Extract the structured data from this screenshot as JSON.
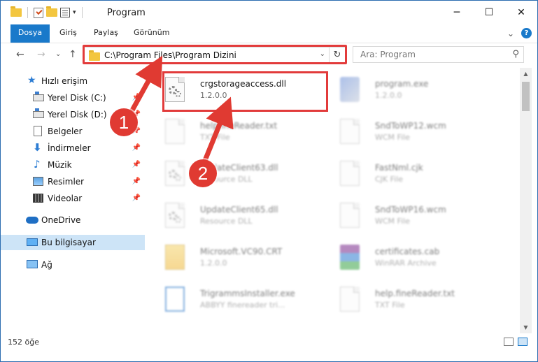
{
  "window": {
    "title": "Program",
    "controls": {
      "minimize": "─",
      "maximize": "☐",
      "close": "✕"
    }
  },
  "ribbon": {
    "tabs": [
      {
        "label": "Dosya",
        "active": true
      },
      {
        "label": "Giriş"
      },
      {
        "label": "Paylaş"
      },
      {
        "label": "Görünüm"
      }
    ],
    "expand_chevron": "⌄",
    "help": "?"
  },
  "navigation": {
    "back": "←",
    "forward": "→",
    "recent": "⌄",
    "up": "↑",
    "address_path": "C:\\Program Files\\Program Dizini",
    "address_dropdown": "⌄",
    "refresh": "↻",
    "search_placeholder": "Ara: Program",
    "search_icon": "⚲"
  },
  "sidebar": {
    "items": [
      {
        "label": "Hızlı erişim",
        "icon": "star-icon"
      },
      {
        "label": "Yerel Disk (C:)",
        "icon": "drive-icon",
        "pinned": true
      },
      {
        "label": "Yerel Disk (D:)",
        "icon": "drive-icon",
        "pinned": true
      },
      {
        "label": "Belgeler",
        "icon": "documents-icon",
        "pinned": true
      },
      {
        "label": "İndirmeler",
        "icon": "download-icon",
        "pinned": true
      },
      {
        "label": "Müzik",
        "icon": "music-icon",
        "pinned": true
      },
      {
        "label": "Resimler",
        "icon": "pictures-icon",
        "pinned": true
      },
      {
        "label": "Videolar",
        "icon": "videos-icon",
        "pinned": true
      },
      {
        "label": "OneDrive",
        "icon": "onedrive-icon"
      },
      {
        "label": "Bu bilgisayar",
        "icon": "this-pc-icon",
        "selected": true
      },
      {
        "label": "Ağ",
        "icon": "network-icon"
      }
    ],
    "pin_glyph": "📌"
  },
  "files": [
    {
      "name": "crgstorageaccess.dll",
      "sub": "1.2.0.0",
      "icon": "dll-icon",
      "highlighted": true
    },
    {
      "name": "program.exe",
      "sub": "1.2.0.0",
      "icon": "exe-icon"
    },
    {
      "name": "helpfineReader.txt",
      "sub": "TXT File",
      "icon": "page-icon"
    },
    {
      "name": "SndToWP12.wcm",
      "sub": "WCM File",
      "icon": "page-icon"
    },
    {
      "name": "UpdateClient63.dll",
      "sub": "Resource DLL",
      "icon": "dll-icon"
    },
    {
      "name": "FastNml.cjk",
      "sub": "CJK File",
      "icon": "page-icon"
    },
    {
      "name": "UpdateClient65.dll",
      "sub": "Resource DLL",
      "icon": "dll-icon"
    },
    {
      "name": "SndToWP16.wcm",
      "sub": "WCM File",
      "icon": "page-icon"
    },
    {
      "name": "Microsoft.VC90.CRT",
      "sub": "1.2.0.0",
      "icon": "manifest-icon"
    },
    {
      "name": "certificates.cab",
      "sub": "WinRAR Archive",
      "icon": "winrar-icon"
    },
    {
      "name": "TrigrammsInstaller.exe",
      "sub": "ABBYY finereader tri...",
      "icon": "installer-icon"
    },
    {
      "name": "help.fineReader.txt",
      "sub": "TXT File",
      "icon": "page-icon"
    }
  ],
  "status": {
    "item_count": "152 öğe"
  },
  "callouts": {
    "one": "1",
    "two": "2"
  },
  "colors": {
    "accent": "#1979ca",
    "highlight": "#e23b3b",
    "selected_bg": "#cde4f7"
  }
}
